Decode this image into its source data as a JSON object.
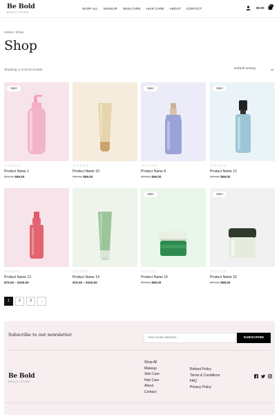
{
  "brand": {
    "name": "Be Bold",
    "tagline": "BEAUTY STORE"
  },
  "nav": [
    "SHOP ALL",
    "MAKEUP",
    "SKIN CARE",
    "HAIR CARE",
    "ABOUT",
    "CONTACT"
  ],
  "header": {
    "cart_amount": "$0.00",
    "cart_count": "0"
  },
  "breadcrumb": "Home / Shop",
  "page_title": "Shop",
  "results_text": "Showing 1–8 of 20 results",
  "sort": {
    "selected": "Default sorting"
  },
  "stars": "☆☆☆☆☆",
  "products": [
    {
      "name": "Product Name 1",
      "sale": "Sale!",
      "old_price": "$75.00",
      "new_price": "$59.00",
      "bg": "#f7e4ea"
    },
    {
      "name": "Product Name 10",
      "sale": "",
      "old_price": "$70.00",
      "new_price": "$59.00",
      "bg": "#f6ecdd"
    },
    {
      "name": "Product Name 8",
      "sale": "Sale!",
      "old_price": "$70.00",
      "new_price": "$59.00",
      "bg": "#ececf8"
    },
    {
      "name": "Product Name 12",
      "sale": "Sale!",
      "old_price": "$70.00",
      "new_price": "$59.00",
      "bg": "#eaf3f8"
    },
    {
      "name": "Product Name 13",
      "sale": "",
      "price_range": "$75.00 – $100.00",
      "bg": "#f7e4ea"
    },
    {
      "name": "Product Name 14",
      "sale": "",
      "price_range": "$75.00 – $100.00",
      "bg": "#eef4ec"
    },
    {
      "name": "Product Name 15",
      "sale": "Sale!",
      "old_price": "$70.00",
      "new_price": "$59.00",
      "bg": "#e9f6ea"
    },
    {
      "name": "Product Name 16",
      "sale": "Sale!",
      "old_price": "$70.00",
      "new_price": "$59.00",
      "bg": "#f1f1f1"
    }
  ],
  "pagination": [
    "1",
    "2",
    "3",
    "→"
  ],
  "footer": {
    "newsletter_title": "Subscribe to our newsletter",
    "email_placeholder": "Your email address...",
    "subscribe_label": "SUBSCRIBE",
    "col1": [
      "Shop All",
      "Makeup",
      "Skin Care",
      "Hair Care",
      "About",
      "Contact"
    ],
    "col2": [
      "Refund Policy",
      "Terms & Conditions",
      "FAQ",
      "Privacy Policy"
    ]
  },
  "colors": {
    "accent": "#000000",
    "footer_bg": "#f7eef0"
  }
}
